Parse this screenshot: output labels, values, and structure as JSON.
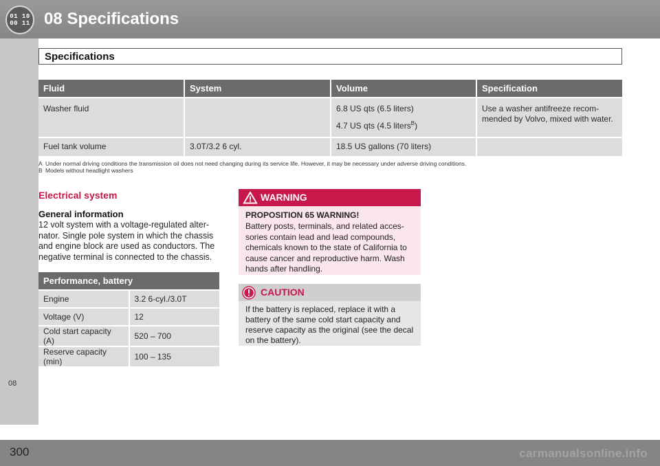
{
  "header": {
    "icon_codes": [
      "01 10",
      "00 11"
    ],
    "chapter_title": "08  Specifications"
  },
  "side_tab": {
    "label": "08"
  },
  "section": {
    "title": "Specifications"
  },
  "fluid_table": {
    "columns": [
      "Fluid",
      "System",
      "Volume",
      "Specification"
    ],
    "washer": {
      "fluid": "Washer fluid",
      "system": "",
      "volume_1": "6.8 US qts (6.5 liters)",
      "volume_2": "4.7 US qts (4.5 liters",
      "volume_2_sup": "B",
      "volume_2_close": ")",
      "specification": "Use a washer antifreeze recom-mended by Volvo, mixed with water."
    },
    "fuel": {
      "fluid": "Fuel tank volume",
      "system": "3.0T/3.2 6 cyl.",
      "volume": "18.5 US gallons (70 liters)",
      "specification": ""
    }
  },
  "footnotes": {
    "a_mark": "A",
    "a_text": "Under normal driving conditions the transmission oil does not need changing during its service life. However, it may be necessary under adverse driving conditions.",
    "b_mark": "B",
    "b_text": "Models without headlight washers"
  },
  "electrical": {
    "heading": "Electrical system",
    "general_heading": "General information",
    "general_body": "12 volt system with a voltage-regulated alter-nator. Single pole system in which the chassis and engine block are used as conductors. The negative terminal is connected to the chassis."
  },
  "battery_table": {
    "title": "Performance, battery",
    "rows": [
      {
        "label": "Engine",
        "value": "3.2 6-cyl./3.0T"
      },
      {
        "label": "Voltage (V)",
        "value": "12"
      },
      {
        "label": "Cold start capacity (A)",
        "value": "520 – 700"
      },
      {
        "label": "Reserve capacity (min)",
        "value": "100 – 135"
      }
    ]
  },
  "warning": {
    "title": "WARNING",
    "subtitle": "PROPOSITION 65 WARNING!",
    "body": "Battery posts, terminals, and related acces-sories contain lead and lead compounds, chemicals known to the state of California to cause cancer and reproductive harm. Wash hands after handling.",
    "accent_color": "#c8174a"
  },
  "caution": {
    "title": "CAUTION",
    "body": "If the battery is replaced, replace it with a battery of the same cold start capacity and reserve capacity as the original (see the decal on the battery)."
  },
  "footer": {
    "page_number": "300",
    "watermark": "carmanualsonline.info"
  }
}
